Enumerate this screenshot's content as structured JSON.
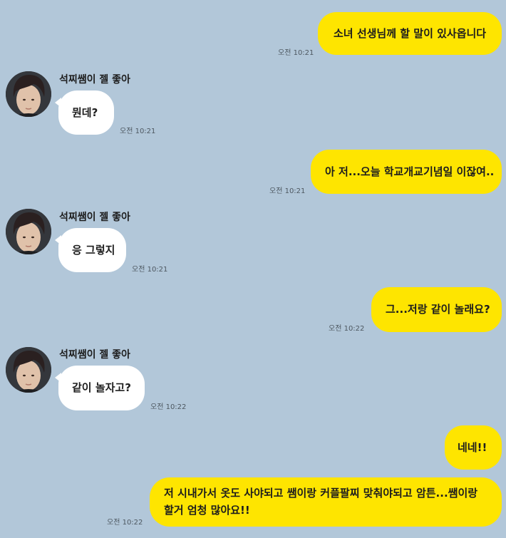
{
  "messages": [
    {
      "sender": "me",
      "text": "소녀 선생님께 할 말이 있사옵니다",
      "time": "오전 10:21"
    },
    {
      "sender": "other",
      "name": "석찌쌤이 젤 좋아",
      "text": "뭔데?",
      "time": "오전 10:21"
    },
    {
      "sender": "me",
      "text": "아 저...오늘 학교개교기념일 이잖여..",
      "time": "오전 10:21"
    },
    {
      "sender": "other",
      "name": "석찌쌤이 젤 좋아",
      "text": "응 그렇지",
      "time": "오전 10:21"
    },
    {
      "sender": "me",
      "text": "그...저랑 같이 놀래요?",
      "time": "오전 10:22"
    },
    {
      "sender": "other",
      "name": "석찌쌤이 젤 좋아",
      "text": "같이 놀자고?",
      "time": "오전 10:22"
    },
    {
      "sender": "me",
      "text": "네네!!",
      "time": ""
    },
    {
      "sender": "me",
      "text": "저 시내가서 옷도 사야되고 쌤이랑 커플팔찌 맞춰야되고 암튼...쌤이랑 할거 엄청 많아요!!",
      "time": "오전 10:22"
    }
  ],
  "colors": {
    "background": "#b2c7d9",
    "my_bubble": "#fee500",
    "their_bubble": "#ffffff"
  }
}
